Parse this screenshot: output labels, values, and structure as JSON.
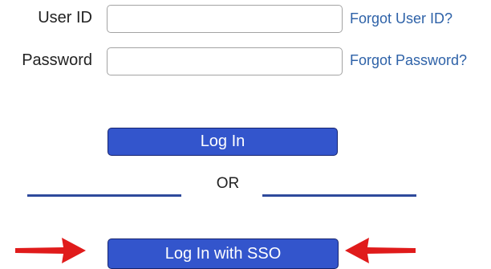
{
  "login_form": {
    "user_id_label": "User ID",
    "user_id_value": "",
    "password_label": "Password",
    "password_value": "",
    "forgot_user_id_link": "Forgot User ID?",
    "forgot_password_link": "Forgot Password?",
    "login_button": "Log In",
    "or_separator": "OR",
    "sso_button": "Log In with SSO"
  },
  "annotations": {
    "arrow_color": "#e01b1b",
    "left_arrow_icon": "arrow-right-icon",
    "right_arrow_icon": "arrow-left-icon"
  },
  "colors": {
    "button_fill": "#3355cc",
    "link": "#2e62a8",
    "divider": "#2e4a9c"
  }
}
